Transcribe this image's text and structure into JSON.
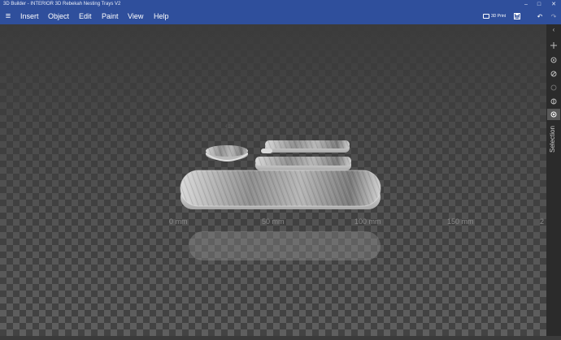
{
  "window": {
    "title": "3D Builder - INTERIOR 3D Rebekah Nesting Trays V2",
    "minimize_glyph": "–",
    "maximize_glyph": "□",
    "close_glyph": "✕"
  },
  "menu": {
    "hamburger_glyph": "≡",
    "items": [
      {
        "label": "Insert"
      },
      {
        "label": "Object"
      },
      {
        "label": "Edit"
      },
      {
        "label": "Paint"
      },
      {
        "label": "View"
      },
      {
        "label": "Help"
      }
    ],
    "print_label": "3D Print",
    "save_glyph": "💾",
    "undo_glyph": "↶",
    "redo_glyph": "↷"
  },
  "side_panel": {
    "collapse_glyph": "‹",
    "label": "Selection",
    "icons": [
      "move-icon",
      "rotate-icon",
      "scale-icon",
      "circle-icon",
      "mirror-icon",
      "selection-icon"
    ]
  },
  "ruler": {
    "labels": [
      "0 mm",
      "50 mm",
      "100 mm",
      "150 mm",
      "2"
    ]
  },
  "colors": {
    "accent": "#2f4f9c",
    "floor_dark": "#3e3e3e",
    "floor_light": "#666666",
    "panel": "#2b2b2b"
  }
}
